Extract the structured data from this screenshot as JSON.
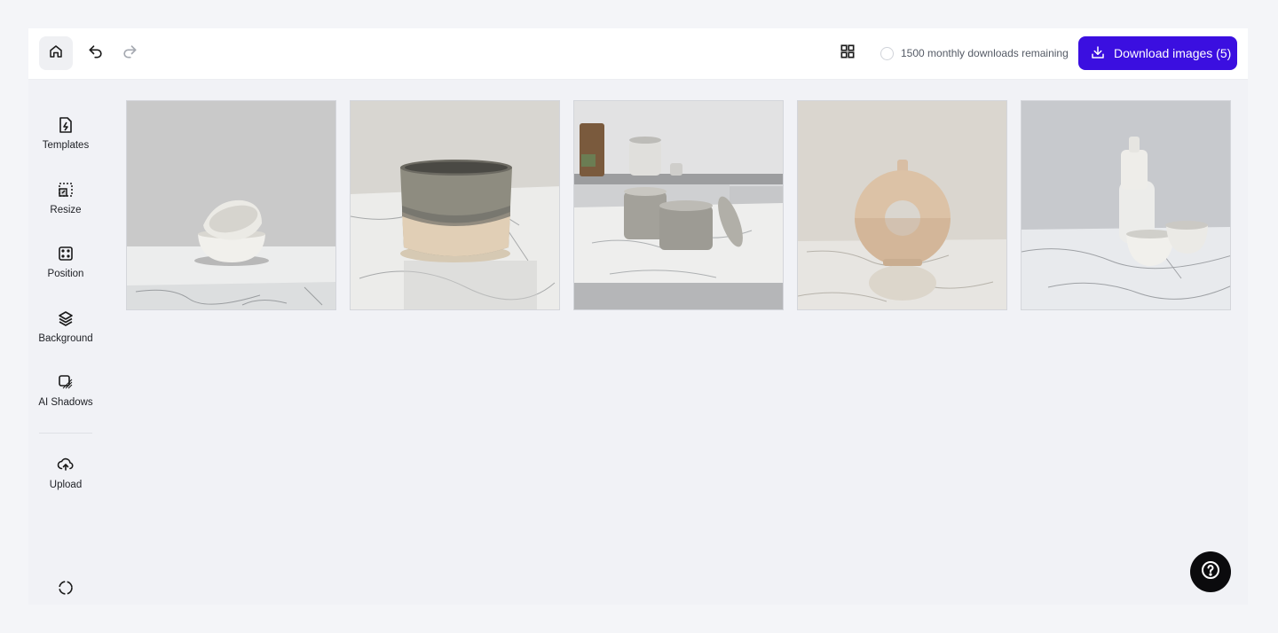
{
  "toolbar": {
    "home_icon": "home-icon",
    "undo_icon": "undo-icon",
    "redo_icon": "redo-icon",
    "grid_icon": "grid-view-icon",
    "downloads_remaining": "1500 monthly downloads remaining",
    "download_label": "Download images (5)",
    "accent_color": "#3b0fe0"
  },
  "sidebar": {
    "items": [
      {
        "label": "Templates",
        "icon": "templates-icon"
      },
      {
        "label": "Resize",
        "icon": "resize-icon"
      },
      {
        "label": "Position",
        "icon": "position-icon"
      },
      {
        "label": "Background",
        "icon": "layers-icon"
      },
      {
        "label": "AI Shadows",
        "icon": "shadow-icon"
      },
      {
        "label": "Upload",
        "icon": "upload-icon"
      }
    ]
  },
  "gallery": {
    "images": [
      {
        "subject": "stacked speckled ceramic bowls on marble"
      },
      {
        "subject": "glazed ceramic cup on marble"
      },
      {
        "subject": "ceramic jars on kitchen counter"
      },
      {
        "subject": "beige donut vase on marble"
      },
      {
        "subject": "white bottle and cups on marble"
      }
    ]
  },
  "help": {
    "icon": "help-icon"
  }
}
